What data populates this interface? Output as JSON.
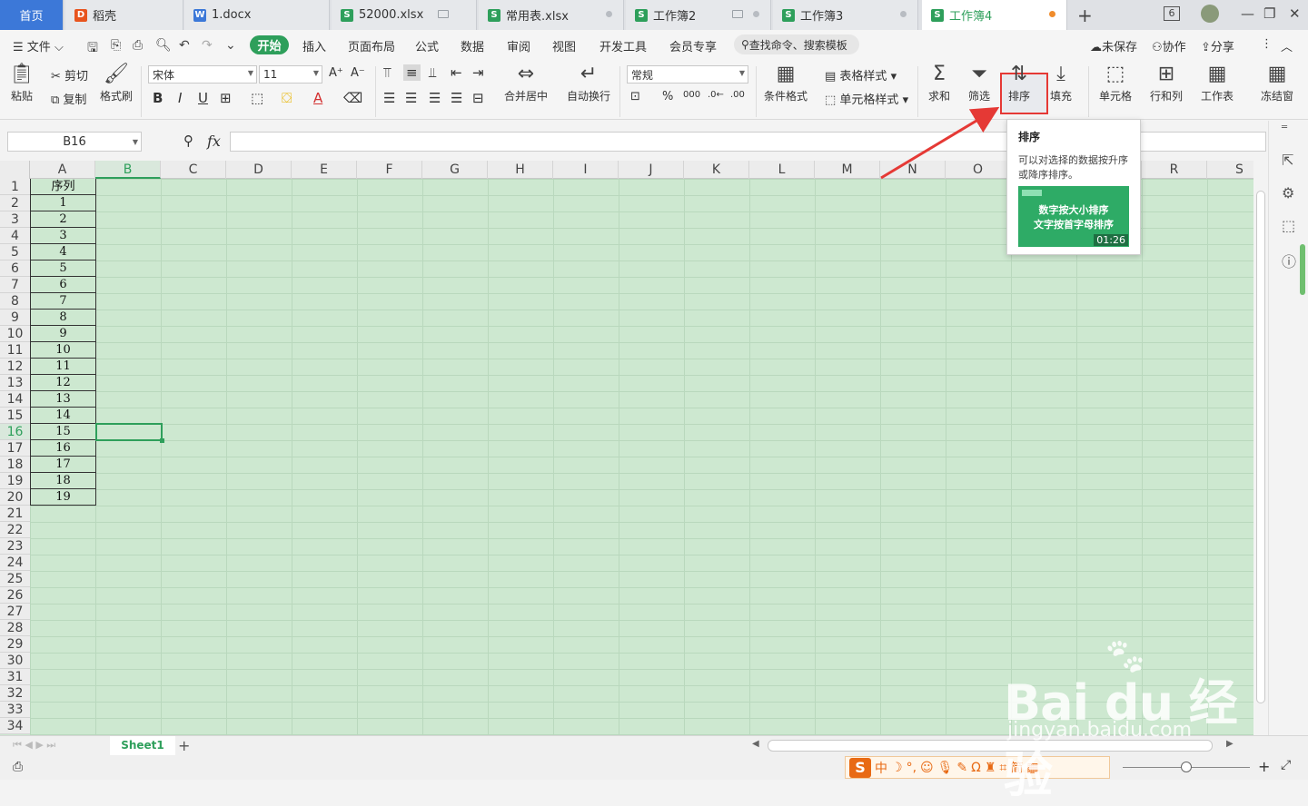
{
  "tabs": [
    {
      "label": "首页",
      "type": "home"
    },
    {
      "label": "稻壳",
      "type": "docer"
    },
    {
      "label": "1.docx",
      "type": "word"
    },
    {
      "label": "52000.xlsx",
      "type": "sheet"
    },
    {
      "label": "常用表.xlsx",
      "type": "sheet"
    },
    {
      "label": "工作簿2",
      "type": "sheet"
    },
    {
      "label": "工作簿3",
      "type": "sheet"
    },
    {
      "label": "工作簿4",
      "type": "sheet",
      "active": true
    }
  ],
  "titlebar": {
    "new_tab": "+",
    "window_count": "6",
    "min": "—",
    "max": "❐",
    "close": "✕"
  },
  "menu": {
    "file": "文件",
    "start": "开始",
    "insert": "插入",
    "layout": "页面布局",
    "formula": "公式",
    "data": "数据",
    "review": "审阅",
    "view": "视图",
    "dev": "开发工具",
    "vip": "会员专享",
    "search_placeholder": "查找命令、搜索模板",
    "unsaved": "未保存",
    "collab": "协作",
    "share": "分享"
  },
  "ribbon": {
    "paste": "粘贴",
    "cut": "剪切",
    "copy": "复制",
    "format_painter": "格式刷",
    "font_name": "宋体",
    "font_size": "11",
    "merge_center": "合并居中",
    "wrap_text": "自动换行",
    "number_format": "常规",
    "cond_format": "条件格式",
    "table_style": "表格样式",
    "cell_style": "单元格样式",
    "sum": "求和",
    "filter": "筛选",
    "sort": "排序",
    "fill": "填充",
    "cell": "单元格",
    "rowcol": "行和列",
    "worksheet": "工作表",
    "freeze": "冻结窗"
  },
  "formula_bar": {
    "name_box": "B16",
    "fx": "fx",
    "content": ""
  },
  "columns": [
    "A",
    "B",
    "C",
    "D",
    "E",
    "F",
    "G",
    "H",
    "I",
    "J",
    "K",
    "L",
    "M",
    "N",
    "O",
    "P",
    "Q",
    "R",
    "S"
  ],
  "rows": [
    "1",
    "2",
    "3",
    "4",
    "5",
    "6",
    "7",
    "8",
    "9",
    "10",
    "11",
    "12",
    "13",
    "14",
    "15",
    "16",
    "17",
    "18",
    "19",
    "20",
    "21",
    "22",
    "23",
    "24",
    "25",
    "26",
    "27",
    "28",
    "29",
    "30",
    "31",
    "32",
    "33",
    "34"
  ],
  "cells_A": [
    "序列",
    "1",
    "2",
    "3",
    "4",
    "5",
    "6",
    "7",
    "8",
    "9",
    "10",
    "11",
    "12",
    "13",
    "14",
    "15",
    "16",
    "17",
    "18",
    "19"
  ],
  "selected_cell": "B16",
  "tooltip": {
    "title": "排序",
    "desc": "可以对选择的数据按升序或降序排序。",
    "video_line1": "数字按大小排序",
    "video_line2": "文字按首字母排序",
    "duration": "01:26"
  },
  "sheet_tabs": [
    "Sheet1"
  ],
  "ime": {
    "lang": "中"
  },
  "watermark": {
    "brand": "Bai du 经验",
    "url": "jingyan.baidu.com"
  },
  "colors": {
    "accent": "#2e9f5b",
    "highlight": "#e53935",
    "eye_protect": "#cde8d0"
  }
}
